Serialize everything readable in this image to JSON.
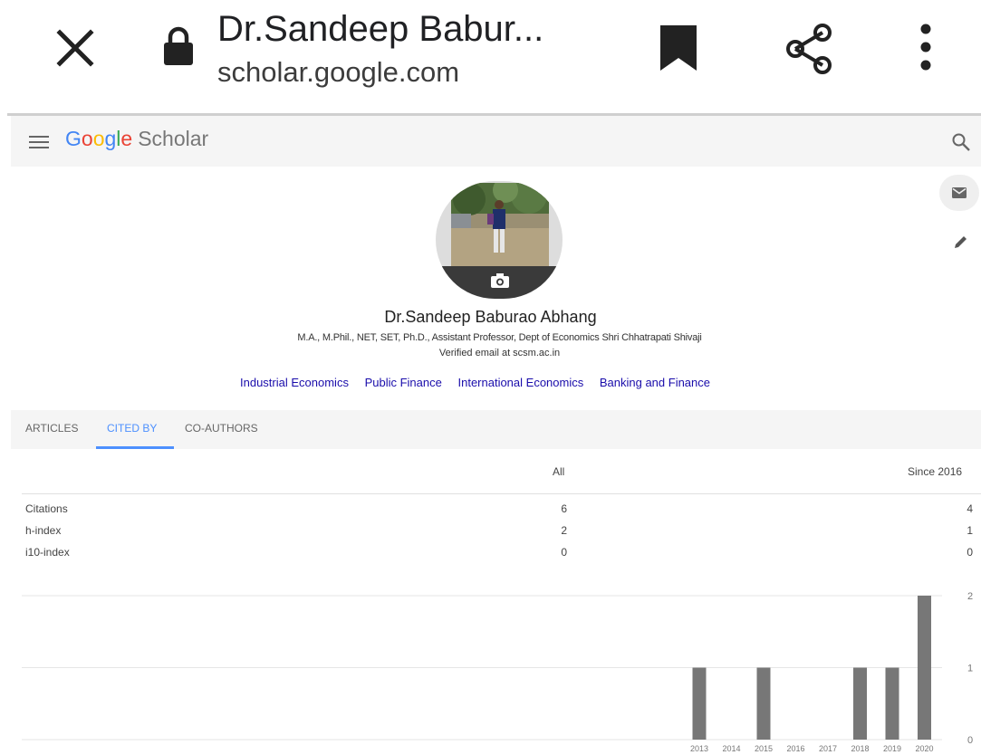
{
  "browser": {
    "title": "Dr.Sandeep Babur...",
    "url": "scholar.google.com",
    "icons": [
      "close-icon",
      "lock-icon",
      "bookmark-icon",
      "share-icon",
      "more-vert-icon"
    ]
  },
  "scholar": {
    "logo_letters": [
      "G",
      "o",
      "o",
      "g",
      "l",
      "e"
    ],
    "logo_suffix": "Scholar",
    "colors": {
      "accent": "#4d90fe",
      "link": "#1a0dab",
      "bar": "#777777"
    }
  },
  "profile": {
    "name": "Dr.Sandeep Baburao Abhang",
    "affiliation": "M.A., M.Phil., NET, SET, Ph.D., Assistant Professor, Dept of Economics Shri Chhatrapati Shivaji",
    "verified": "Verified email at scsm.ac.in",
    "interests": [
      "Industrial Economics",
      "Public Finance",
      "International Economics",
      "Banking and Finance"
    ]
  },
  "tabs": [
    {
      "label": "ARTICLES",
      "active": false
    },
    {
      "label": "CITED BY",
      "active": true
    },
    {
      "label": "CO-AUTHORS",
      "active": false
    }
  ],
  "citations": {
    "col_all": "All",
    "col_since": "Since 2016",
    "rows": [
      {
        "label": "Citations",
        "all": "6",
        "since": "4"
      },
      {
        "label": "h-index",
        "all": "2",
        "since": "1"
      },
      {
        "label": "i10-index",
        "all": "0",
        "since": "0"
      }
    ]
  },
  "chart_data": {
    "type": "bar",
    "categories": [
      "2013",
      "2014",
      "2015",
      "2016",
      "2017",
      "2018",
      "2019",
      "2020"
    ],
    "values": [
      1,
      0,
      1,
      0,
      0,
      1,
      1,
      2
    ],
    "ylim": [
      0,
      2
    ],
    "yticks": [
      0,
      1,
      2
    ],
    "grid": true,
    "color": "#777777"
  }
}
